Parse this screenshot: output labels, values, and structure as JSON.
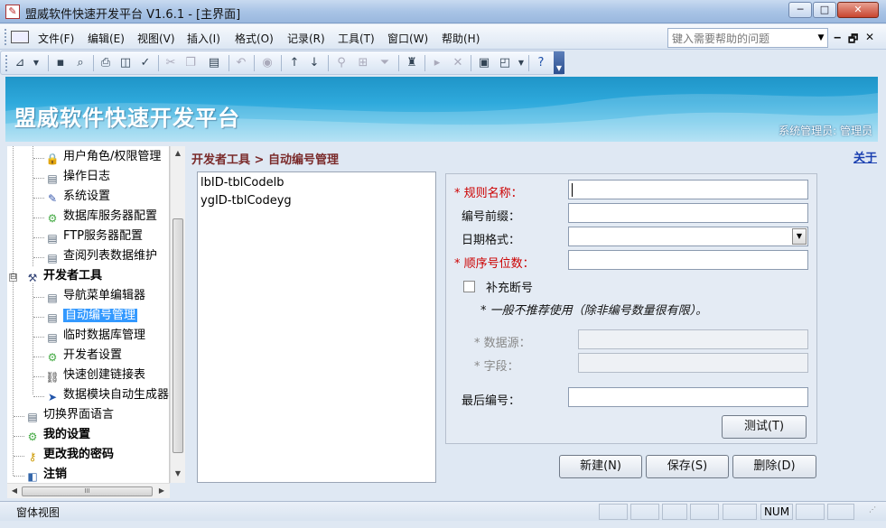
{
  "window": {
    "title": "盟威软件快速开发平台 V1.6.1 - [主界面]",
    "minimize": "─",
    "maximize": "□",
    "close": "✕"
  },
  "menubar": {
    "items": [
      "文件(F)",
      "编辑(E)",
      "视图(V)",
      "插入(I)",
      "格式(O)",
      "记录(R)",
      "工具(T)",
      "窗口(W)",
      "帮助(H)"
    ],
    "help_placeholder": "键入需要帮助的问题",
    "mdi_min": "‒",
    "mdi_restore": "🗗",
    "mdi_close": "✕"
  },
  "banner": {
    "title": "盟威软件快速开发平台",
    "user": "系统管理员: 管理员"
  },
  "tree": {
    "items": [
      {
        "label": "用户角色/权限管理",
        "icon": "lock-icon"
      },
      {
        "label": "操作日志",
        "icon": "document-icon"
      },
      {
        "label": "系统设置",
        "icon": "settings-icon"
      },
      {
        "label": "数据库服务器配置",
        "icon": "gear-icon"
      },
      {
        "label": "FTP服务器配置",
        "icon": "document-icon"
      },
      {
        "label": "查阅列表数据维护",
        "icon": "document-icon"
      },
      {
        "label": "开发者工具",
        "icon": "tools-icon"
      },
      {
        "label": "导航菜单编辑器",
        "icon": "document-icon"
      },
      {
        "label": "自动编号管理",
        "icon": "document-icon"
      },
      {
        "label": "临时数据库管理",
        "icon": "document-icon"
      },
      {
        "label": "开发者设置",
        "icon": "gear-icon"
      },
      {
        "label": "快速创建链接表",
        "icon": "link-icon"
      },
      {
        "label": "数据模块自动生成器",
        "icon": "cursor-icon"
      },
      {
        "label": "切换界面语言",
        "icon": "document-icon"
      },
      {
        "label": "我的设置",
        "icon": "gear-icon"
      },
      {
        "label": "更改我的密码",
        "icon": "key-icon"
      },
      {
        "label": "注销",
        "icon": "logout-icon"
      }
    ],
    "expander": "⊟",
    "hscroll_thumb": "III"
  },
  "main": {
    "breadcrumb": "开发者工具 > 自动编号管理",
    "about": "关于",
    "list": [
      "lbID-tblCodelb",
      "ygID-tblCodeyg"
    ],
    "form": {
      "rule_name_label": "规则名称：",
      "prefix_label": "编号前缀：",
      "date_format_label": "日期格式：",
      "seq_digits_label": "顺序号位数：",
      "fill_gaps_label": "补充断号",
      "note": "一般不推荐使用（除非编号数量很有限）。",
      "datasource_label": "数据源：",
      "field_label": "字段：",
      "last_number_label": "最后编号：",
      "required_mark": "*",
      "test_button": "测试(T)"
    },
    "buttons": {
      "new": "新建(N)",
      "save": "保存(S)",
      "delete": "删除(D)"
    }
  },
  "statusbar": {
    "text": "窗体视图",
    "num": "NUM"
  }
}
